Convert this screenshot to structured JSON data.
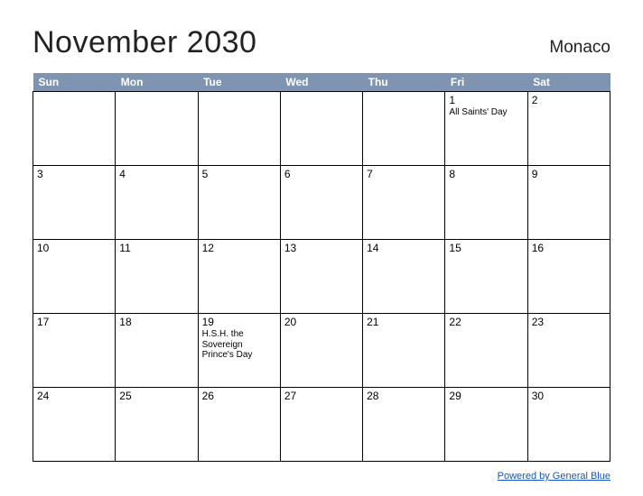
{
  "header": {
    "title": "November 2030",
    "country": "Monaco"
  },
  "dayNames": [
    "Sun",
    "Mon",
    "Tue",
    "Wed",
    "Thu",
    "Fri",
    "Sat"
  ],
  "weeks": [
    [
      {
        "num": "",
        "event": ""
      },
      {
        "num": "",
        "event": ""
      },
      {
        "num": "",
        "event": ""
      },
      {
        "num": "",
        "event": ""
      },
      {
        "num": "",
        "event": ""
      },
      {
        "num": "1",
        "event": "All Saints' Day"
      },
      {
        "num": "2",
        "event": ""
      }
    ],
    [
      {
        "num": "3",
        "event": ""
      },
      {
        "num": "4",
        "event": ""
      },
      {
        "num": "5",
        "event": ""
      },
      {
        "num": "6",
        "event": ""
      },
      {
        "num": "7",
        "event": ""
      },
      {
        "num": "8",
        "event": ""
      },
      {
        "num": "9",
        "event": ""
      }
    ],
    [
      {
        "num": "10",
        "event": ""
      },
      {
        "num": "11",
        "event": ""
      },
      {
        "num": "12",
        "event": ""
      },
      {
        "num": "13",
        "event": ""
      },
      {
        "num": "14",
        "event": ""
      },
      {
        "num": "15",
        "event": ""
      },
      {
        "num": "16",
        "event": ""
      }
    ],
    [
      {
        "num": "17",
        "event": ""
      },
      {
        "num": "18",
        "event": ""
      },
      {
        "num": "19",
        "event": "H.S.H. the Sovereign Prince's Day"
      },
      {
        "num": "20",
        "event": ""
      },
      {
        "num": "21",
        "event": ""
      },
      {
        "num": "22",
        "event": ""
      },
      {
        "num": "23",
        "event": ""
      }
    ],
    [
      {
        "num": "24",
        "event": ""
      },
      {
        "num": "25",
        "event": ""
      },
      {
        "num": "26",
        "event": ""
      },
      {
        "num": "27",
        "event": ""
      },
      {
        "num": "28",
        "event": ""
      },
      {
        "num": "29",
        "event": ""
      },
      {
        "num": "30",
        "event": ""
      }
    ]
  ],
  "footer": {
    "link": "Powered by General Blue"
  }
}
